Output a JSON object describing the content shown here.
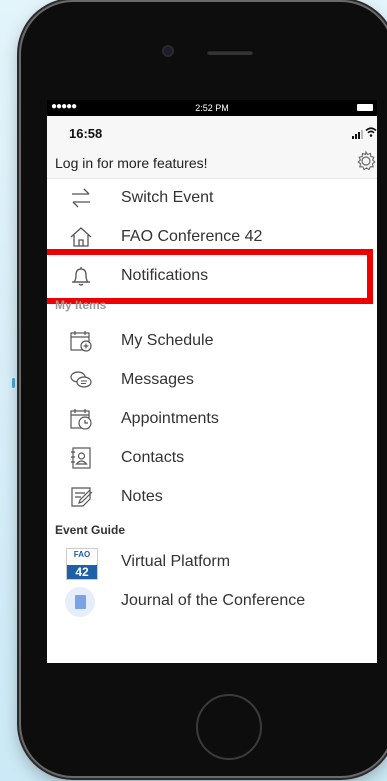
{
  "outer_status": {
    "signal": "●●●●●",
    "time": "2:52 PM"
  },
  "app_status": {
    "time": "16:58"
  },
  "header": {
    "login_prompt": "Log in for more features!"
  },
  "menu": [
    {
      "label": "Switch Event",
      "icon": "switch-arrows-icon"
    },
    {
      "label": "FAO Conference 42",
      "icon": "home-icon"
    },
    {
      "label": "Notifications",
      "icon": "bell-icon",
      "highlighted": true
    }
  ],
  "my_items": {
    "section_label": "My Items",
    "items": [
      {
        "label": "My Schedule",
        "icon": "calendar-add-icon"
      },
      {
        "label": "Messages",
        "icon": "chat-bubbles-icon"
      },
      {
        "label": "Appointments",
        "icon": "calendar-clock-icon"
      },
      {
        "label": "Contacts",
        "icon": "contact-book-icon"
      },
      {
        "label": "Notes",
        "icon": "note-pencil-icon"
      }
    ]
  },
  "event_guide": {
    "section_label": "Event Guide",
    "items": [
      {
        "label": "Virtual Platform",
        "icon": "fao-logo-icon",
        "badge_text": "FAO",
        "badge_number": "42"
      },
      {
        "label": "Journal of the Conference",
        "icon": "document-icon"
      }
    ]
  },
  "colors": {
    "highlight": "#ee0000",
    "icon_stroke": "#555555",
    "badge_blue": "#1f5fa8"
  }
}
